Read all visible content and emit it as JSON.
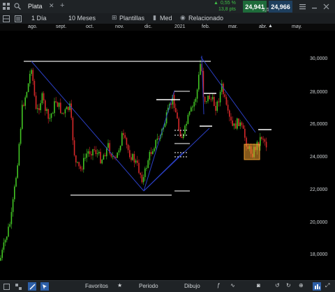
{
  "header": {
    "instrument": "Plata",
    "change_pct": "0,55 %",
    "change_pts": "13,8 pts",
    "bid": "24,941",
    "spread": "2,5",
    "ask": "24,966"
  },
  "toolbar": {
    "interval": "1 Día",
    "range": "10 Meses",
    "templates": "Plantillas",
    "price_type": "Med",
    "related": "Relacionado"
  },
  "months": [
    "ago.",
    "sept.",
    "oct.",
    "nov.",
    "dic.",
    "2021",
    "feb.",
    "mar.",
    "abr.",
    "may."
  ],
  "y_axis": [
    "30,0000",
    "28,0000",
    "26,0000",
    "24,0000",
    "22,0000",
    "20,0000",
    "18,0000"
  ],
  "bottom": {
    "favorites": "Favoritos",
    "period": "Periodo",
    "drawing": "Dibujo"
  },
  "colors": {
    "up": "#43c624",
    "down": "#d8282a",
    "trendline": "#2b3fc4",
    "level": "#ffffff",
    "accent_green": "#1e6b3a",
    "box": "#f0a030"
  }
}
